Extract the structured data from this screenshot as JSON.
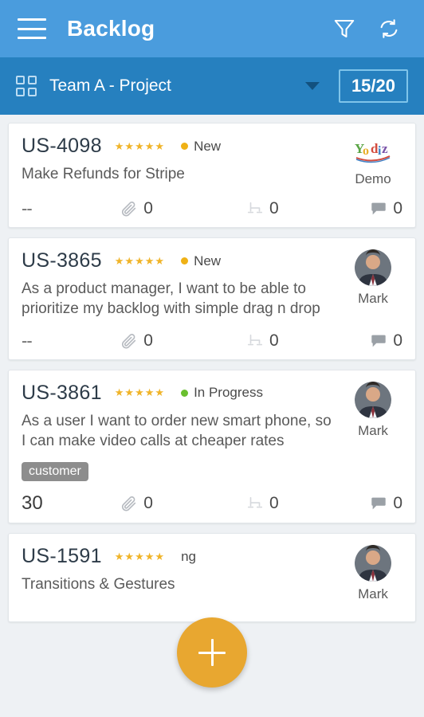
{
  "appbar": {
    "title": "Backlog",
    "menu_icon": "hamburger-menu-icon",
    "filter_icon": "filter-funnel-icon",
    "refresh_icon": "refresh-sync-icon"
  },
  "project_bar": {
    "grid_icon": "grid-squares-icon",
    "project_name": "Team A - Project",
    "dropdown_icon": "chevron-down-icon",
    "count_badge": "15/20"
  },
  "colors": {
    "appbar_bg": "#4a9cdd",
    "subbar_bg": "#2680bf",
    "page_bg": "#eef1f4",
    "card_bg": "#ffffff",
    "star": "#f0b429",
    "status_new": "#efb116",
    "status_in_progress": "#6abf2f",
    "tag_bg": "#8d8d8d",
    "fab_bg": "#e8a730"
  },
  "cards": [
    {
      "id": "US-4098",
      "stars": 5,
      "status": "New",
      "status_color": "#efb116",
      "title": "Make Refunds for Stripe",
      "tags": [],
      "assignee": "Demo",
      "assignee_type": "logo",
      "points": "--",
      "attachments": "0",
      "tasks": "0",
      "comments": "0"
    },
    {
      "id": "US-3865",
      "stars": 5,
      "status": "New",
      "status_color": "#efb116",
      "title": "As a product manager, I want to be able to prioritize my backlog with simple drag n drop",
      "tags": [],
      "assignee": "Mark",
      "assignee_type": "avatar",
      "points": "--",
      "attachments": "0",
      "tasks": "0",
      "comments": "0"
    },
    {
      "id": "US-3861",
      "stars": 5,
      "status": "In Progress",
      "status_color": "#6abf2f",
      "title": "As a user I want to order new smart phone, so I can make video calls at cheaper rates",
      "tags": [
        "customer"
      ],
      "assignee": "Mark",
      "assignee_type": "avatar",
      "points": "30",
      "attachments": "0",
      "tasks": "0",
      "comments": "0"
    },
    {
      "id": "US-1591",
      "stars": 5,
      "status": "ng",
      "status_color": "#efb116",
      "title": "Transitions & Gestures",
      "tags": [],
      "assignee": "Mark",
      "assignee_type": "avatar",
      "points": "",
      "attachments": "",
      "tasks": "",
      "comments": ""
    }
  ],
  "fab": {
    "label": "+",
    "icon": "plus-icon"
  },
  "icons": {
    "attachment": "paperclip-icon",
    "tasks": "subtasks-icon",
    "comment": "comment-bubble-icon",
    "star": "star-icon"
  }
}
